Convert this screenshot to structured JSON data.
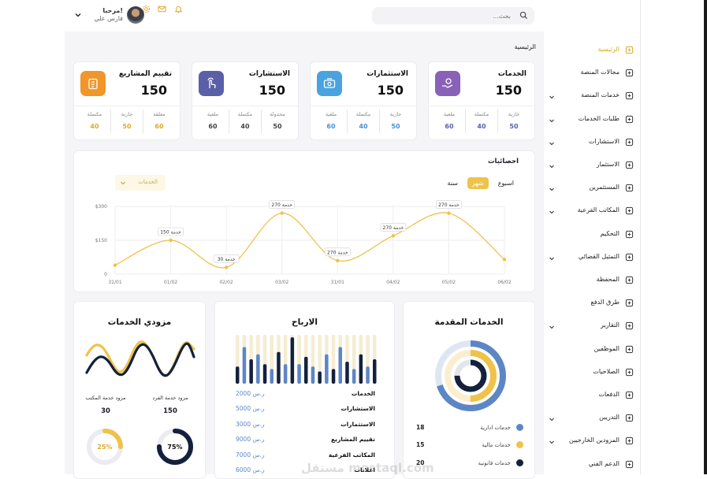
{
  "header": {
    "search_placeholder": "بحث...",
    "greeting": "مرحبا!",
    "user_name": "فارس علي"
  },
  "breadcrumb": "الرئيسية",
  "stat_cards": [
    {
      "title": "الخدمات",
      "total": "150",
      "icon": "hand-coin-icon",
      "color": "#8a61b8",
      "subs": [
        {
          "label": "جارية",
          "value": "50",
          "color": "#5b5fa8"
        },
        {
          "label": "مكتملة",
          "value": "40",
          "color": "#5b5fa8"
        },
        {
          "label": "ملغية",
          "value": "60",
          "color": "#5b5fa8"
        }
      ]
    },
    {
      "title": "الاستثمارات",
      "total": "150",
      "icon": "cash-icon",
      "color": "#4aa3df",
      "subs": [
        {
          "label": "جارية",
          "value": "50",
          "color": "#4a90d0"
        },
        {
          "label": "مكتملة",
          "value": "40",
          "color": "#4a90d0"
        },
        {
          "label": "ملغية",
          "value": "60",
          "color": "#4a90d0"
        }
      ]
    },
    {
      "title": "الاستشارات",
      "total": "150",
      "icon": "hand-pointer-icon",
      "color": "#5b5fa8",
      "subs": [
        {
          "label": "مجدولة",
          "value": "50",
          "color": "#444"
        },
        {
          "label": "مكتملة",
          "value": "40",
          "color": "#444"
        },
        {
          "label": "ملغية",
          "value": "60",
          "color": "#444"
        }
      ]
    },
    {
      "title": "تقييم المشاريع",
      "total": "150",
      "icon": "clipboard-icon",
      "color": "#f0962a",
      "subs": [
        {
          "label": "معلقة",
          "value": "60",
          "color": "#e0a92a"
        },
        {
          "label": "جارية",
          "value": "50",
          "color": "#e0a92a"
        },
        {
          "label": "مكتملة",
          "value": "40",
          "color": "#e0a92a"
        }
      ]
    }
  ],
  "stats_section": {
    "title": "احصائيات",
    "tabs": [
      "اسبوع",
      "شهر",
      "سنة"
    ],
    "active_tab": "شهر",
    "dropdown_value": "الخدمات"
  },
  "chart_data": {
    "type": "line",
    "title": "احصائيات",
    "categories": [
      "31/01",
      "01/02",
      "02/02",
      "03/02",
      "31/01",
      "04/02",
      "05/02",
      "06/02"
    ],
    "x_positions": [
      0,
      1,
      2,
      3,
      4,
      5,
      6,
      7
    ],
    "values": [
      40,
      150,
      30,
      270,
      60,
      170,
      270,
      65
    ],
    "point_labels": [
      {
        "index": 1,
        "text": "150 خدمة"
      },
      {
        "index": 2,
        "text": "30 خدمة"
      },
      {
        "index": 3,
        "text": "270 خدمة"
      },
      {
        "index": 4,
        "text": "270 خدمة"
      },
      {
        "index": 5,
        "text": "270 خدمة"
      },
      {
        "index": 6,
        "text": "270 خدمة"
      }
    ],
    "yticks": [
      {
        "value": 0,
        "label": "0"
      },
      {
        "value": 150,
        "label": "$150"
      },
      {
        "value": 300,
        "label": "$300"
      }
    ],
    "ylim": [
      0,
      300
    ],
    "grid": true,
    "line_color": "#efc24a"
  },
  "offered_services": {
    "title": "الخدمات المقدمة",
    "items": [
      {
        "name": "خدمات ادارية",
        "value": "18",
        "color": "#5d86c5"
      },
      {
        "name": "خدمات مالية",
        "value": "15",
        "color": "#efc24a"
      },
      {
        "name": "خدمات قانونية",
        "value": "20",
        "color": "#14213d"
      }
    ],
    "rings": [
      {
        "color": "#5d86c5",
        "fraction": 0.7,
        "track": "#dfe6f3"
      },
      {
        "color": "#efc24a",
        "fraction": 0.5,
        "track": "#fbeed0"
      },
      {
        "color": "#14213d",
        "fraction": 0.75,
        "track": "#e3e5ec"
      }
    ]
  },
  "profits": {
    "title": "الارباح",
    "rows": [
      {
        "name": "الخدمات",
        "value": "2000 ر.س"
      },
      {
        "name": "الاستشارات",
        "value": "5000 ر.س"
      },
      {
        "name": "الاستثمارات",
        "value": "3000 ر.س"
      },
      {
        "name": "تقييم المشاريع",
        "value": "9000 ر.س"
      },
      {
        "name": "المكاتب الفرعية",
        "value": "7000 ر.س"
      },
      {
        "name": "اعلانات",
        "value": "6000 ر.س"
      }
    ],
    "bars": [
      {
        "v": 0.35,
        "c": "#14213d"
      },
      {
        "v": 0.75,
        "c": "#5d86c5"
      },
      {
        "v": 0.5,
        "c": "#14213d"
      },
      {
        "v": 0.6,
        "c": "#5d86c5"
      },
      {
        "v": 0.4,
        "c": "#14213d"
      },
      {
        "v": 0.3,
        "c": "#5d86c5"
      },
      {
        "v": 0.65,
        "c": "#14213d"
      },
      {
        "v": 0.4,
        "c": "#5d86c5"
      },
      {
        "v": 0.95,
        "c": "#14213d"
      },
      {
        "v": 0.4,
        "c": "#5d86c5"
      },
      {
        "v": 0.55,
        "c": "#14213d"
      },
      {
        "v": 0.35,
        "c": "#5d86c5"
      },
      {
        "v": 0.25,
        "c": "#14213d"
      },
      {
        "v": 0.6,
        "c": "#5d86c5"
      },
      {
        "v": 0.3,
        "c": "#14213d"
      },
      {
        "v": 0.75,
        "c": "#5d86c5"
      },
      {
        "v": 0.45,
        "c": "#14213d"
      },
      {
        "v": 0.3,
        "c": "#5d86c5"
      },
      {
        "v": 0.6,
        "c": "#14213d"
      },
      {
        "v": 0.35,
        "c": "#5d86c5"
      },
      {
        "v": 0.5,
        "c": "#14213d"
      }
    ]
  },
  "providers": {
    "title": "مزودي الخدمات",
    "individual_label": "مزود خدمة الفرد",
    "individual_value": "150",
    "office_label": "مزود خدمة المكتب",
    "office_value": "30",
    "gauge_a": {
      "percent_label": "75%",
      "fraction": 0.75,
      "color": "#14213d"
    },
    "gauge_b": {
      "percent_label": "25%",
      "fraction": 0.25,
      "color": "#efc24a"
    }
  },
  "sidebar": {
    "items": [
      {
        "label": "الرئيسية",
        "icon": "home-icon",
        "active": true,
        "expand": false
      },
      {
        "label": "مجالات المنصة",
        "icon": "list-icon",
        "expand": false
      },
      {
        "label": "خدمات المنصة",
        "icon": "hand-icon",
        "expand": true
      },
      {
        "label": "طلبات الخدمات",
        "icon": "clipboard-list-icon",
        "expand": true
      },
      {
        "label": "الاستشارات",
        "icon": "chat-icon",
        "expand": true
      },
      {
        "label": "الاستثمار",
        "icon": "money-icon",
        "expand": true
      },
      {
        "label": "المستثمرين",
        "icon": "network-icon",
        "expand": true
      },
      {
        "label": "المكاتب الفرعية",
        "icon": "building-icon",
        "expand": true
      },
      {
        "label": "التحكيم",
        "icon": "gavel-icon",
        "expand": false
      },
      {
        "label": "التمثيل القضائي",
        "icon": "court-icon",
        "expand": true
      },
      {
        "label": "المحفظة",
        "icon": "wallet-icon",
        "expand": false
      },
      {
        "label": "طرق الدفع",
        "icon": "card-icon",
        "expand": false
      },
      {
        "label": "التقارير",
        "icon": "report-icon",
        "expand": true
      },
      {
        "label": "الموظفين",
        "icon": "team-icon",
        "expand": false
      },
      {
        "label": "الصلاحيات",
        "icon": "key-icon",
        "expand": false
      },
      {
        "label": "الدفعات",
        "icon": "payment-icon",
        "expand": false
      },
      {
        "label": "التدريبن",
        "icon": "user-plus-icon",
        "expand": true
      },
      {
        "label": "المزودين الخارجيين",
        "icon": "users-icon",
        "expand": true
      },
      {
        "label": "الدعم الفني",
        "icon": "phone-icon",
        "expand": false
      }
    ]
  },
  "watermark": "مستقل mostaql.com"
}
